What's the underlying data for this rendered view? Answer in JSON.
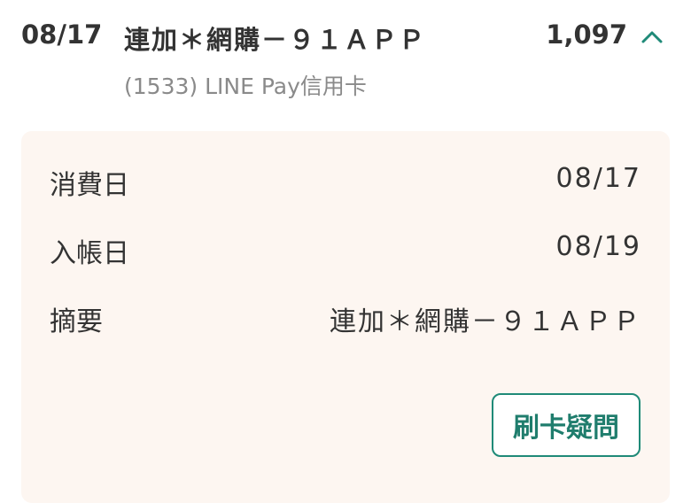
{
  "transaction": {
    "date": "08/17",
    "merchant": "連加＊網購－９１ＡＰＰ",
    "card": "(1533) LINE Pay信用卡",
    "amount": "1,097",
    "expanded_icon": "chevron-up-icon"
  },
  "details": {
    "rows": [
      {
        "label": "消費日",
        "value": "08/17"
      },
      {
        "label": "入帳日",
        "value": "08/19"
      },
      {
        "label": "摘要",
        "value": "連加＊網購－９１ＡＰＰ"
      }
    ],
    "dispute_label": "刷卡疑問"
  },
  "colors": {
    "accent": "#1f8a78",
    "panel_bg": "#fdf6f1",
    "text": "#333333",
    "subtext": "#8a8a8a"
  }
}
